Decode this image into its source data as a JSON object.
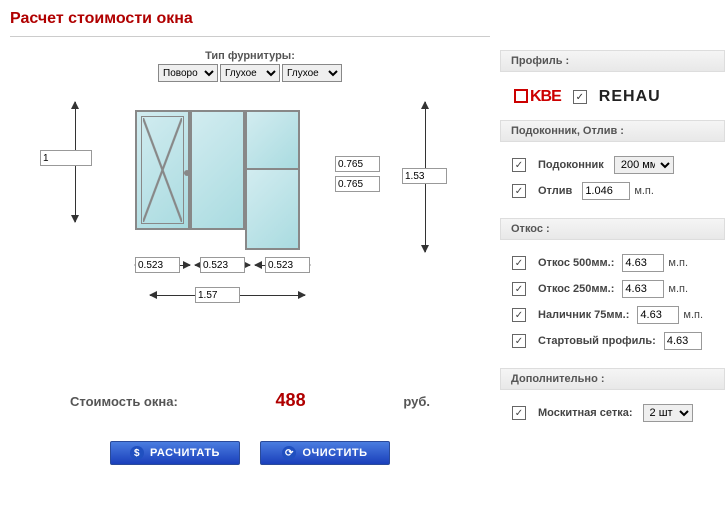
{
  "title": "Расчет стоимости окна",
  "furniture_label": "Тип фурнитуры:",
  "furniture": {
    "sel1": "Поворо",
    "sel2": "Глухое",
    "sel3": "Глухое"
  },
  "dims": {
    "height_left": "1",
    "h_upper": "0.765",
    "h_lower": "0.765",
    "h_total": "1.53",
    "w1": "0.523",
    "w2": "0.523",
    "w3": "0.523",
    "w_total": "1.57"
  },
  "price": {
    "label": "Стоимость окна:",
    "value": "488",
    "unit": "руб."
  },
  "buttons": {
    "calc": "РАСЧИТАТЬ",
    "clear": "ОЧИСТИТЬ"
  },
  "sections": {
    "profile": "Профиль :",
    "sill": "Подоконник, Отлив :",
    "slope": "Откос :",
    "extra": "Дополнительно :"
  },
  "profile": {
    "kbe": "KBE",
    "rehau": "REHAU"
  },
  "sill": {
    "sill_label": "Подоконник",
    "sill_val": "200 мм",
    "ebb_label": "Отлив",
    "ebb_val": "1.046",
    "unit": "м.п."
  },
  "slope": {
    "s500_label": "Откос 500мм.:",
    "s500_val": "4.63",
    "s250_label": "Откос 250мм.:",
    "s250_val": "4.63",
    "casing_label": "Наличник 75мм.:",
    "casing_val": "4.63",
    "start_label": "Стартовый профиль:",
    "start_val": "4.63",
    "unit": "м.п."
  },
  "extra": {
    "mesh_label": "Москитная сетка:",
    "mesh_val": "2 шт"
  }
}
